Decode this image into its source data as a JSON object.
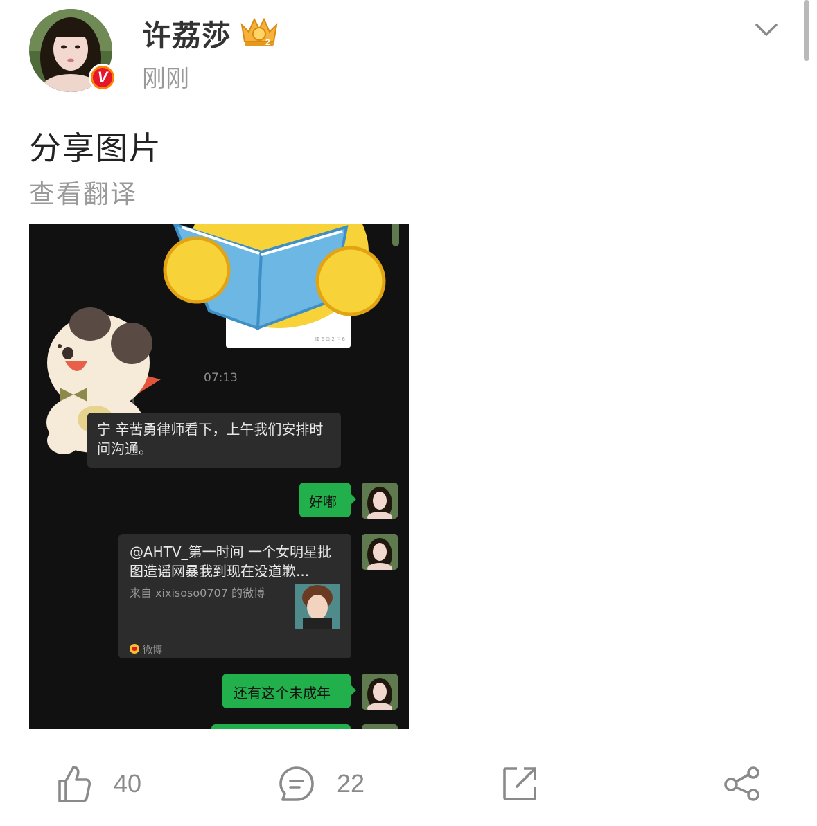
{
  "post": {
    "username": "许荔莎",
    "timestamp": "刚刚",
    "text": "分享图片",
    "translate_label": "查看翻译"
  },
  "chat_screenshot": {
    "time": "07:13",
    "received_message": "宁 辛苦勇律师看下，上午我们安排时间沟通。",
    "sent_message_1": "好嘟",
    "link_card": {
      "title": "@AHTV_第一时间 一个女明星批图造谣网暴我到现在没道歉...",
      "source": "来自 xixisoso0707 的微博",
      "app_label": "微博"
    },
    "sent_message_2": "还有这个未成年",
    "embedded_card_stats": "ΙΣ 6   ⊡ 2   ⚐ 6"
  },
  "actions": {
    "like_count": "40",
    "comment_count": "22"
  },
  "icons": [
    "verified-v-icon",
    "crown-level-icon",
    "chevron-down-icon",
    "like-icon",
    "comment-icon",
    "repost-icon",
    "share-icon"
  ],
  "colors": {
    "accent_green": "#21b04b",
    "verified_red": "#e6162d",
    "muted_gray": "#999999"
  }
}
